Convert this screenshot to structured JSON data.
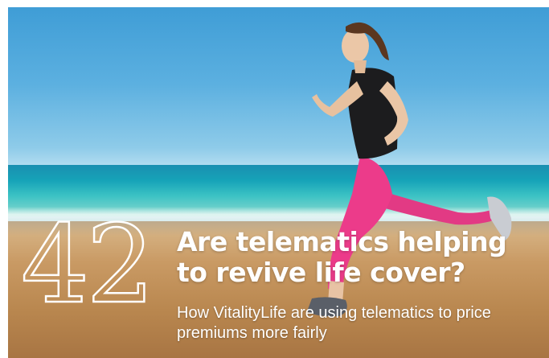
{
  "feature": {
    "number": "42",
    "headline": "Are telematics helping to revive life cover?",
    "subhead": "How VitalityLife are using telematics to price premiums more fairly"
  },
  "photo": {
    "subject": "woman-running-on-beach",
    "colors": {
      "sky": "#5cb0e0",
      "sea": "#16a3b8",
      "sand": "#c99a64",
      "leggings": "#e8317f",
      "top": "#1a1a1a"
    }
  }
}
